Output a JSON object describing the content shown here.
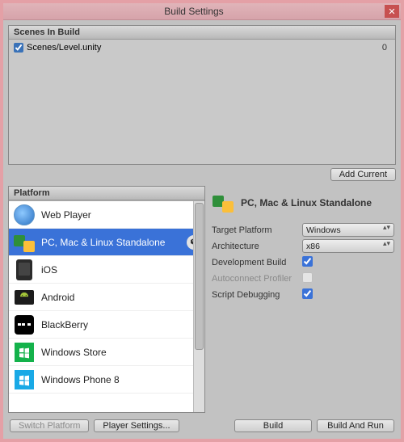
{
  "window_title": "Build Settings",
  "scenes_group_title": "Scenes In Build",
  "scenes": [
    {
      "checked": true,
      "path": "Scenes/Level.unity",
      "index": "0"
    }
  ],
  "add_current_label": "Add Current",
  "platform_group_title": "Platform",
  "platforms": [
    {
      "key": "web",
      "label": "Web Player"
    },
    {
      "key": "pc",
      "label": "PC, Mac & Linux Standalone",
      "selected": true,
      "current": true
    },
    {
      "key": "ios",
      "label": "iOS"
    },
    {
      "key": "android",
      "label": "Android"
    },
    {
      "key": "bb",
      "label": "BlackBerry"
    },
    {
      "key": "winstore",
      "label": "Windows Store"
    },
    {
      "key": "winphone",
      "label": "Windows Phone 8"
    }
  ],
  "right": {
    "title": "PC, Mac & Linux Standalone",
    "target_platform_label": "Target Platform",
    "target_platform_value": "Windows",
    "architecture_label": "Architecture",
    "architecture_value": "x86",
    "development_build_label": "Development Build",
    "development_build_checked": true,
    "autoconnect_profiler_label": "Autoconnect Profiler",
    "autoconnect_profiler_checked": false,
    "script_debugging_label": "Script Debugging",
    "script_debugging_checked": true
  },
  "footer": {
    "switch_platform": "Switch Platform",
    "player_settings": "Player Settings...",
    "build": "Build",
    "build_and_run": "Build And Run"
  }
}
